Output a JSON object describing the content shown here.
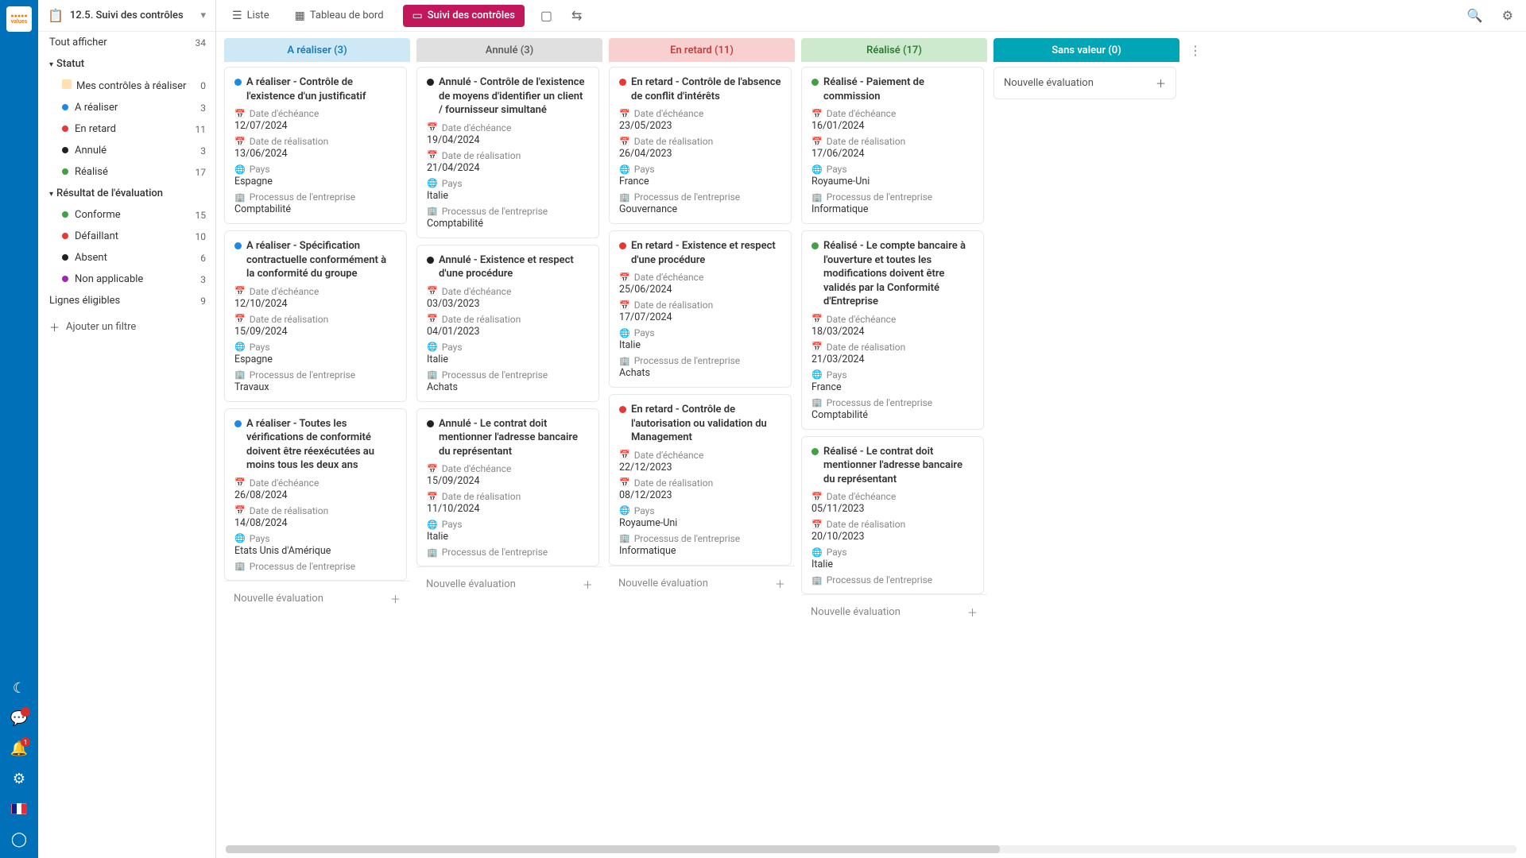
{
  "page_title": "12.5. Suivi des contrôles",
  "toolbar": {
    "list": "Liste",
    "dashboard": "Tableau de bord",
    "active": "Suivi des contrôles"
  },
  "sidebar": {
    "show_all": "Tout afficher",
    "show_all_count": "34",
    "groups": [
      {
        "label": "Statut",
        "items": [
          {
            "kind": "person",
            "label": "Mes contrôles à réaliser",
            "count": "0"
          },
          {
            "kind": "dot",
            "color": "#1e88e5",
            "label": "A réaliser",
            "count": "3"
          },
          {
            "kind": "dot",
            "color": "#e53935",
            "label": "En retard",
            "count": "11"
          },
          {
            "kind": "dot",
            "color": "#212121",
            "label": "Annulé",
            "count": "3"
          },
          {
            "kind": "dot",
            "color": "#43a047",
            "label": "Réalisé",
            "count": "17"
          }
        ]
      },
      {
        "label": "Résultat de l'évaluation",
        "items": [
          {
            "kind": "dot",
            "color": "#43a047",
            "label": "Conforme",
            "count": "15"
          },
          {
            "kind": "dot",
            "color": "#e53935",
            "label": "Défaillant",
            "count": "10"
          },
          {
            "kind": "dot",
            "color": "#212121",
            "label": "Absent",
            "count": "6"
          },
          {
            "kind": "dot",
            "color": "#9c27b0",
            "label": "Non applicable",
            "count": "3"
          }
        ]
      }
    ],
    "eligible": {
      "label": "Lignes éligibles",
      "count": "9"
    },
    "add_filter": "Ajouter un filtre"
  },
  "labels": {
    "due": "Date d'échéance",
    "done": "Date de réalisation",
    "country": "Pays",
    "process": "Processus de l'entreprise",
    "new_eval": "Nouvelle évaluation"
  },
  "columns": [
    {
      "cls": "col-a",
      "title": "A réaliser (3)",
      "dot": "#1e88e5",
      "cards": [
        {
          "title": "A réaliser - Contrôle de l'existence d'un justificatif",
          "due": "12/07/2024",
          "done": "13/06/2024",
          "country": "Espagne",
          "process": "Comptabilité"
        },
        {
          "title": "A réaliser - Spécification contractuelle conformément à la conformité du groupe",
          "due": "12/10/2024",
          "done": "15/09/2024",
          "country": "Espagne",
          "process": "Travaux"
        },
        {
          "title": "A réaliser - Toutes les vérifications de conformité doivent être réexécutées au moins tous les deux ans",
          "due": "26/08/2024",
          "done": "14/08/2024",
          "country": "Etats Unis d'Amérique",
          "process": ""
        }
      ]
    },
    {
      "cls": "col-b",
      "title": "Annulé (3)",
      "dot": "#212121",
      "cards": [
        {
          "title": "Annulé - Contrôle de l'existence de moyens d'identifier un client / fournisseur simultané",
          "due": "19/04/2024",
          "done": "21/04/2024",
          "country": "Italie",
          "process": "Comptabilité"
        },
        {
          "title": "Annulé - Existence et respect d'une procédure",
          "due": "03/03/2023",
          "done": "04/01/2023",
          "country": "Italie",
          "process": "Achats"
        },
        {
          "title": "Annulé - Le contrat doit mentionner l'adresse bancaire du représentant",
          "due": "15/09/2024",
          "done": "11/10/2024",
          "country": "Italie",
          "process": ""
        }
      ]
    },
    {
      "cls": "col-c",
      "title": "En retard (11)",
      "dot": "#e53935",
      "cards": [
        {
          "title": "En retard - Contrôle de l'absence de conflit d'intérêts",
          "due": "23/05/2023",
          "done": "26/04/2023",
          "country": "France",
          "process": "Gouvernance"
        },
        {
          "title": "En retard - Existence et respect d'une procédure",
          "due": "25/06/2024",
          "done": "17/07/2024",
          "country": "Italie",
          "process": "Achats"
        },
        {
          "title": "En retard - Contrôle de l'autorisation ou validation du Management",
          "due": "22/12/2023",
          "done": "08/12/2023",
          "country": "Royaume-Uni",
          "process": "Informatique"
        }
      ]
    },
    {
      "cls": "col-d",
      "title": "Réalisé (17)",
      "dot": "#43a047",
      "cards": [
        {
          "title": "Réalisé - Paiement de commission",
          "due": "16/01/2024",
          "done": "17/06/2024",
          "country": "Royaume-Uni",
          "process": "Informatique"
        },
        {
          "title": "Réalisé - Le compte bancaire à l'ouverture et toutes les modifications doivent être validés par la Conformité d'Entreprise",
          "due": "18/03/2024",
          "done": "21/03/2024",
          "country": "France",
          "process": "Comptabilité"
        },
        {
          "title": "Réalisé - Le contrat doit mentionner l'adresse bancaire du représentant",
          "due": "05/11/2023",
          "done": "20/10/2023",
          "country": "Italie",
          "process": ""
        }
      ]
    },
    {
      "cls": "col-e",
      "title": "Sans valeur (0)",
      "dot": "",
      "cards": [],
      "empty": true
    }
  ],
  "notification_count": "1"
}
